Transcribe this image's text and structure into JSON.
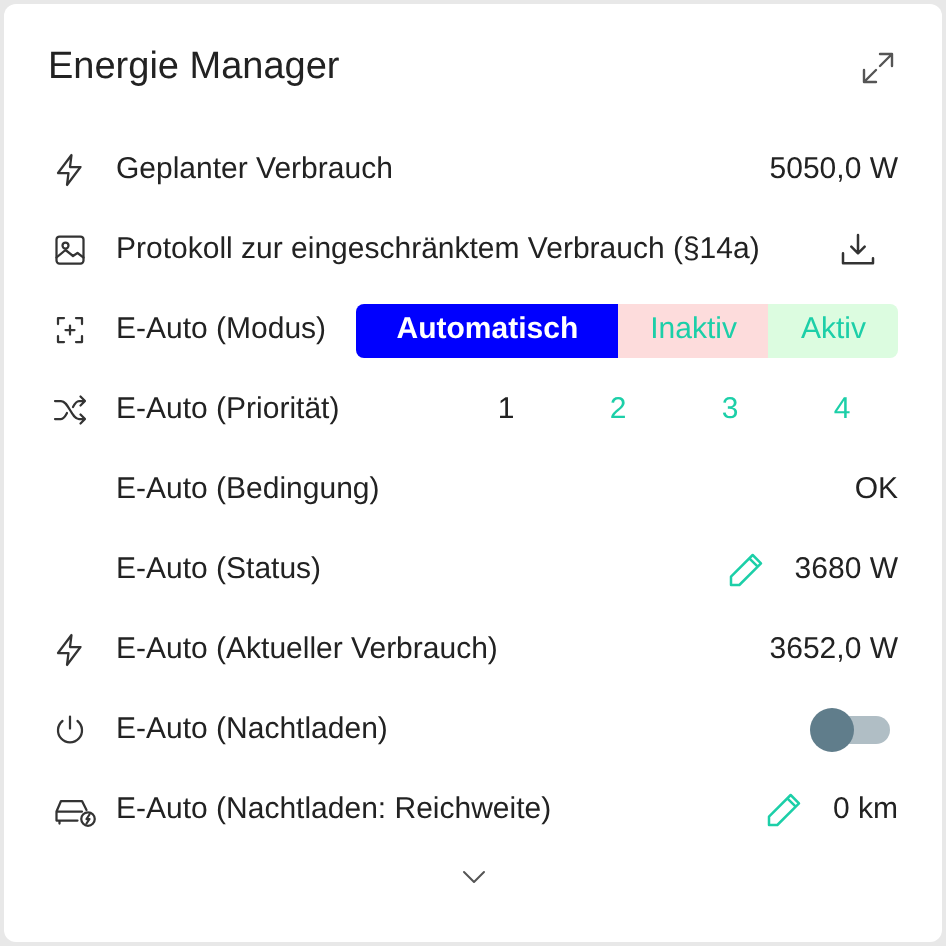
{
  "card": {
    "title": "Energie Manager"
  },
  "rows": [
    {
      "kind": "value",
      "label": "Geplanter Verbrauch",
      "value": "5050,0 W"
    },
    {
      "kind": "download",
      "label": "Protokoll zur eingeschränktem Verbrauch (§14a)"
    },
    {
      "kind": "segmented",
      "label": "E-Auto (Modus)",
      "options": [
        {
          "label": "Automatisch",
          "selected": true,
          "color": "#0000ff"
        },
        {
          "label": "Inaktiv",
          "selected": false,
          "color": "#fddcdc"
        },
        {
          "label": "Aktiv",
          "selected": false,
          "color": "#dcfce0"
        }
      ]
    },
    {
      "kind": "priority",
      "label": "E-Auto (Priorität)",
      "options": [
        {
          "label": "1",
          "selected": true
        },
        {
          "label": "2",
          "selected": false
        },
        {
          "label": "3",
          "selected": false
        },
        {
          "label": "4",
          "selected": false
        }
      ]
    },
    {
      "kind": "value",
      "label": "E-Auto (Bedingung)",
      "value": "OK"
    },
    {
      "kind": "edit",
      "label": "E-Auto (Status)",
      "value": "3680 W"
    },
    {
      "kind": "value",
      "label": "E-Auto (Aktueller Verbrauch)",
      "value": "3652,0 W"
    },
    {
      "kind": "toggle",
      "label": "E-Auto (Nachtladen)",
      "on": false
    },
    {
      "kind": "edit",
      "label": "E-Auto (Nachtladen: Reichweite)",
      "value": "0 km"
    }
  ]
}
